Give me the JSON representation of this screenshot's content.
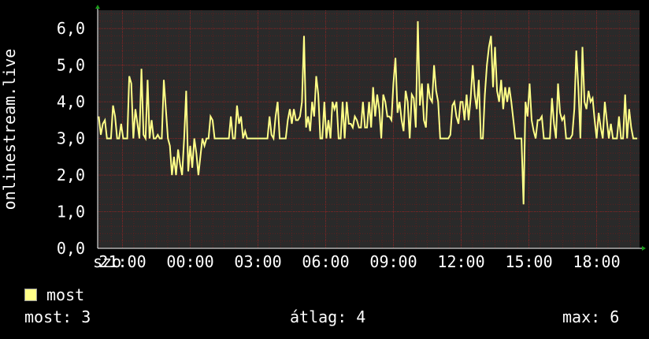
{
  "chart_data": {
    "type": "line",
    "ylabel": "onlinestream.live",
    "xlabel": "",
    "ylim": [
      0,
      6.5
    ],
    "yticks": [
      0,
      1,
      2,
      3,
      4,
      5,
      6
    ],
    "ytick_labels": [
      "0,0",
      "1,0",
      "2,0",
      "3,0",
      "4,0",
      "5,0",
      "6,0"
    ],
    "xticks": [
      {
        "label": "szo",
        "t": -2
      },
      {
        "label": "21:00",
        "t": 1
      },
      {
        "label": "00:00",
        "t": 4
      },
      {
        "label": "03:00",
        "t": 7
      },
      {
        "label": "06:00",
        "t": 10
      },
      {
        "label": "09:00",
        "t": 13
      },
      {
        "label": "12:00",
        "t": 16
      },
      {
        "label": "15:00",
        "t": 19
      },
      {
        "label": "18:00",
        "t": 22
      }
    ],
    "xlim": [
      -0.1,
      23.9
    ],
    "grid": true,
    "colors": {
      "line": "#ffff88",
      "background": "#000000",
      "grid": "#5a2020",
      "axis": "#ffffff"
    },
    "legend_position": "bottom-left",
    "series": [
      {
        "name": "most",
        "t": [
          -0.05,
          0.04,
          0.13,
          0.22,
          0.31,
          0.4,
          0.49,
          0.58,
          0.67,
          0.76,
          0.85,
          0.94,
          1.03,
          1.12,
          1.21,
          1.3,
          1.39,
          1.48,
          1.57,
          1.66,
          1.75,
          1.84,
          1.93,
          2.02,
          2.11,
          2.2,
          2.29,
          2.38,
          2.47,
          2.56,
          2.65,
          2.74,
          2.83,
          2.92,
          3.01,
          3.1,
          3.19,
          3.28,
          3.37,
          3.46,
          3.55,
          3.64,
          3.73,
          3.82,
          3.91,
          4.0,
          4.09,
          4.18,
          4.27,
          4.36,
          4.45,
          4.54,
          4.63,
          4.72,
          4.81,
          4.9,
          4.99,
          5.08,
          5.17,
          5.26,
          5.35,
          5.44,
          5.53,
          5.62,
          5.71,
          5.8,
          5.89,
          5.98,
          6.07,
          6.16,
          6.25,
          6.34,
          6.43,
          6.52,
          6.61,
          6.7,
          6.79,
          6.88,
          6.97,
          7.06,
          7.15,
          7.24,
          7.33,
          7.42,
          7.51,
          7.6,
          7.69,
          7.78,
          7.87,
          7.96,
          8.05,
          8.14,
          8.23,
          8.32,
          8.41,
          8.5,
          8.59,
          8.68,
          8.77,
          8.86,
          8.95,
          9.04,
          9.13,
          9.22,
          9.31,
          9.4,
          9.49,
          9.58,
          9.67,
          9.76,
          9.85,
          9.94,
          10.03,
          10.12,
          10.21,
          10.3,
          10.39,
          10.48,
          10.57,
          10.66,
          10.75,
          10.84,
          10.93,
          11.02,
          11.11,
          11.2,
          11.29,
          11.38,
          11.47,
          11.56,
          11.65,
          11.74,
          11.83,
          11.92,
          12.01,
          12.1,
          12.19,
          12.28,
          12.37,
          12.46,
          12.55,
          12.64,
          12.73,
          12.82,
          12.91,
          13.0,
          13.09,
          13.18,
          13.27,
          13.36,
          13.45,
          13.54,
          13.63,
          13.72,
          13.81,
          13.9,
          13.99,
          14.08,
          14.17,
          14.26,
          14.35,
          14.44,
          14.53,
          14.62,
          14.71,
          14.8,
          14.89,
          14.98,
          15.07,
          15.16,
          15.25,
          15.34,
          15.43,
          15.52,
          15.61,
          15.7,
          15.79,
          15.88,
          15.97,
          16.06,
          16.15,
          16.24,
          16.33,
          16.42,
          16.51,
          16.6,
          16.69,
          16.78,
          16.87,
          16.96,
          17.05,
          17.14,
          17.23,
          17.32,
          17.41,
          17.5,
          17.59,
          17.68,
          17.77,
          17.86,
          17.95,
          18.04,
          18.13,
          18.22,
          18.31,
          18.4,
          18.49,
          18.58,
          18.67,
          18.76,
          18.85,
          18.94,
          19.03,
          19.12,
          19.21,
          19.3,
          19.39,
          19.48,
          19.57,
          19.66,
          19.75,
          19.84,
          19.93,
          20.02,
          20.11,
          20.2,
          20.29,
          20.38,
          20.47,
          20.56,
          20.65,
          20.74,
          20.83,
          20.92,
          21.01,
          21.1,
          21.19,
          21.28,
          21.37,
          21.46,
          21.55,
          21.64,
          21.73,
          21.82,
          21.91,
          22.0,
          22.09,
          22.18,
          22.27,
          22.36,
          22.45,
          22.54,
          22.63,
          22.72,
          22.81,
          22.9,
          22.99,
          23.08,
          23.17,
          23.26,
          23.35,
          23.44,
          23.53,
          23.62,
          23.71,
          23.8
        ],
        "values": [
          3.6,
          3.1,
          3.4,
          3.5,
          3.0,
          3.0,
          3.0,
          3.9,
          3.6,
          3.0,
          3.0,
          3.4,
          3.0,
          3.0,
          3.0,
          4.7,
          4.5,
          3.0,
          3.8,
          3.4,
          3.0,
          4.9,
          3.1,
          3.0,
          4.6,
          3.0,
          3.5,
          3.0,
          3.0,
          3.1,
          3.0,
          3.0,
          4.6,
          3.8,
          3.0,
          2.8,
          2.0,
          2.5,
          2.0,
          2.7,
          2.3,
          2.0,
          3.0,
          4.3,
          2.1,
          2.8,
          2.2,
          3.0,
          2.6,
          2.0,
          2.5,
          3.0,
          2.8,
          3.0,
          3.0,
          3.6,
          3.5,
          3.0,
          3.0,
          3.0,
          3.0,
          3.0,
          3.0,
          3.0,
          3.0,
          3.6,
          3.0,
          3.0,
          3.9,
          3.4,
          3.6,
          3.0,
          3.2,
          3.0,
          3.0,
          3.0,
          3.0,
          3.0,
          3.0,
          3.0,
          3.0,
          3.0,
          3.0,
          3.0,
          3.6,
          3.1,
          3.0,
          3.6,
          4.0,
          3.0,
          3.0,
          3.0,
          3.0,
          3.5,
          3.8,
          3.4,
          3.8,
          3.5,
          3.5,
          3.6,
          4.0,
          5.8,
          3.3,
          3.6,
          3.2,
          4.0,
          3.6,
          4.7,
          4.2,
          3.0,
          3.0,
          4.0,
          3.0,
          3.5,
          3.0,
          4.0,
          3.8,
          4.0,
          3.0,
          3.0,
          4.0,
          3.0,
          4.0,
          3.4,
          3.4,
          3.3,
          3.6,
          3.5,
          3.3,
          3.3,
          4.0,
          3.3,
          3.3,
          4.0,
          3.3,
          4.4,
          3.6,
          4.2,
          3.8,
          3.0,
          4.2,
          4.0,
          3.6,
          3.6,
          3.5,
          4.5,
          5.2,
          3.7,
          4.0,
          3.5,
          3.2,
          4.3,
          4.0,
          3.0,
          4.2,
          4.1,
          3.3,
          6.2,
          3.9,
          4.5,
          3.5,
          3.3,
          4.5,
          4.1,
          4.0,
          5.0,
          4.3,
          4.0,
          3.0,
          3.0,
          3.0,
          3.0,
          3.0,
          3.1,
          3.9,
          4.0,
          3.6,
          3.4,
          4.0,
          4.0,
          3.5,
          4.2,
          3.5,
          4.1,
          5.0,
          4.2,
          3.8,
          4.6,
          3.0,
          3.0,
          4.2,
          5.0,
          5.5,
          5.8,
          4.4,
          5.5,
          4.3,
          4.0,
          4.6,
          3.8,
          4.4,
          4.0,
          4.4,
          4.0,
          3.5,
          3.0,
          3.0,
          3.0,
          3.0,
          1.2,
          4.0,
          3.6,
          4.5,
          3.5,
          3.2,
          3.0,
          3.5,
          3.5,
          3.6,
          3.0,
          3.0,
          3.0,
          3.0,
          4.1,
          3.4,
          3.0,
          4.5,
          3.7,
          3.5,
          3.6,
          3.0,
          3.0,
          3.0,
          3.1,
          3.8,
          5.4,
          4.4,
          3.0,
          5.5,
          4.0,
          3.8,
          4.3,
          4.0,
          4.1,
          3.5,
          3.0,
          3.7,
          3.3,
          3.0,
          4.0,
          3.5,
          3.0,
          3.4,
          3.0,
          3.0,
          3.0,
          3.6,
          3.0,
          3.0,
          4.2,
          3.0,
          3.8,
          3.3,
          3.0,
          3.0,
          3.0,
          3.4,
          3.0,
          3.6,
          3.4,
          3.5,
          3.2,
          3.8,
          3.0
        ]
      }
    ]
  },
  "legend": {
    "label": "most"
  },
  "stats": {
    "now": "most: 3",
    "avg": "átlag: 4",
    "max": "max: 6"
  }
}
